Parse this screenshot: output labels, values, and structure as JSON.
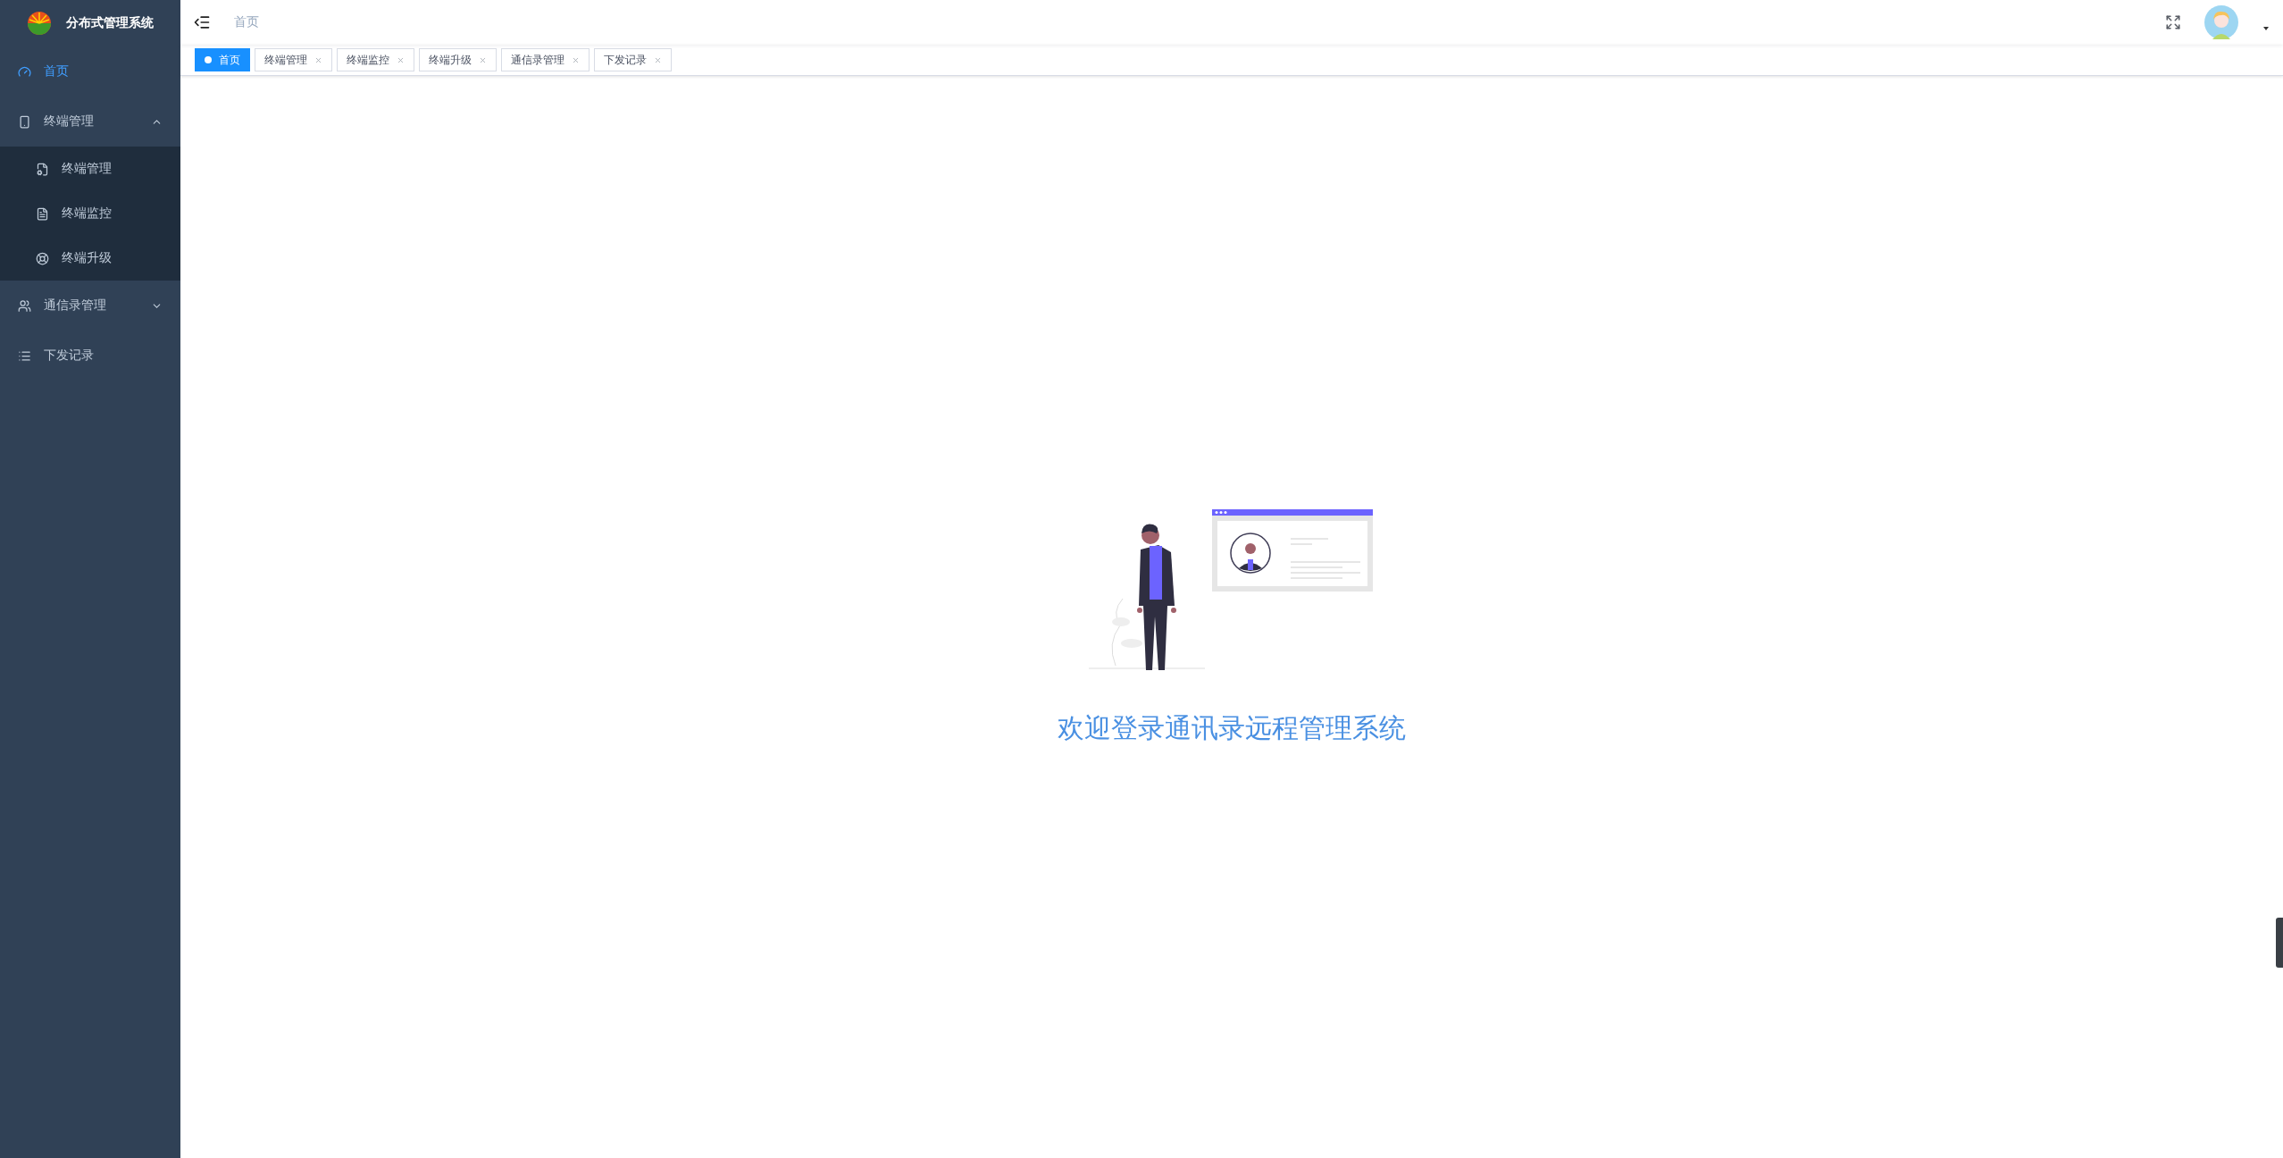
{
  "app": {
    "title": "分布式管理系统"
  },
  "sidebar": {
    "items": [
      {
        "kind": "item",
        "label": "首页",
        "selected": true
      },
      {
        "kind": "submenu",
        "label": "终端管理",
        "expanded": true,
        "selected": false,
        "children": [
          {
            "label": "终端管理",
            "selected": false
          },
          {
            "label": "终端监控",
            "selected": false
          },
          {
            "label": "终端升级",
            "selected": false
          }
        ]
      },
      {
        "kind": "submenu",
        "label": "通信录管理",
        "expanded": false,
        "selected": false
      },
      {
        "kind": "item",
        "label": "下发记录",
        "selected": false
      }
    ]
  },
  "breadcrumb": [
    "首页"
  ],
  "tabs": [
    {
      "kind": "fixed",
      "label": "首页",
      "selected": true
    },
    {
      "kind": "closable",
      "label": "终端管理",
      "selected": false
    },
    {
      "kind": "closable",
      "label": "终端监控",
      "selected": false
    },
    {
      "kind": "closable",
      "label": "终端升级",
      "selected": false
    },
    {
      "kind": "closable",
      "label": "通信录管理",
      "selected": false
    },
    {
      "kind": "closable",
      "label": "下发记录",
      "selected": false
    }
  ],
  "welcome": {
    "text": "欢迎登录通讯录远程管理系统"
  }
}
